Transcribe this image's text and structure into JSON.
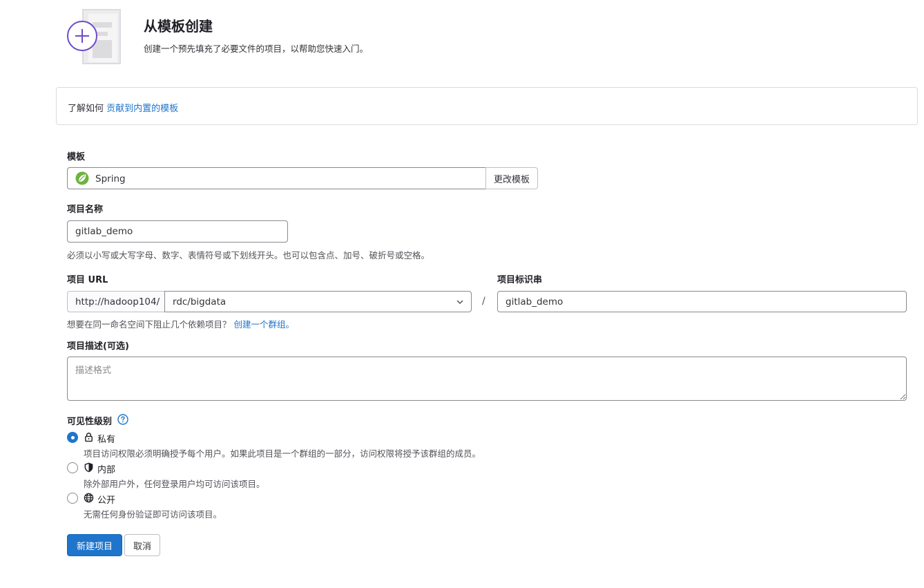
{
  "header": {
    "title": "从模板创建",
    "subtitle": "创建一个预先填充了必要文件的项目，以帮助您快速入门。"
  },
  "info": {
    "prefix": "了解如何",
    "link_text": "贡献到内置的模板"
  },
  "template": {
    "label": "模板",
    "selected": "Spring",
    "icon": "spring-leaf-icon",
    "change_button": "更改模板"
  },
  "project_name": {
    "label": "项目名称",
    "value": "gitlab_demo",
    "help": "必须以小写或大写字母、数字、表情符号或下划线开头。也可以包含点、加号、破折号或空格。"
  },
  "project_url": {
    "label": "项目 URL",
    "prefix": "http://hadoop104/",
    "namespace": "rdc/bigdata",
    "separator": "/",
    "help_text": "想要在同一命名空间下阻止几个依赖项目？",
    "help_link": "创建一个群组。"
  },
  "project_slug": {
    "label": "项目标识串",
    "value": "gitlab_demo"
  },
  "description": {
    "label": "项目描述(可选)",
    "placeholder": "描述格式"
  },
  "visibility": {
    "label": "可见性级别",
    "options": [
      {
        "label": "私有",
        "icon": "lock-icon",
        "checked": true,
        "description": "项目访问权限必须明确授予每个用户。如果此项目是一个群组的一部分，访问权限将授予该群组的成员。"
      },
      {
        "label": "内部",
        "icon": "shield-icon",
        "checked": false,
        "description": "除外部用户外，任何登录用户均可访问该项目。"
      },
      {
        "label": "公开",
        "icon": "globe-icon",
        "checked": false,
        "description": "无需任何身份验证即可访问该项目。"
      }
    ]
  },
  "actions": {
    "create": "新建项目",
    "cancel": "取消"
  },
  "colors": {
    "primary": "#1f75cb",
    "link": "#1f75cb",
    "illustration_purple": "#6e49cb",
    "spring_green": "#6db33f"
  }
}
